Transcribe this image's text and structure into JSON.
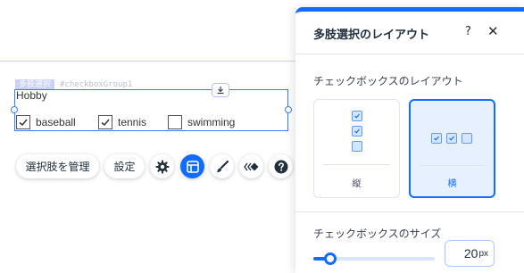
{
  "canvas": {
    "element_type": "多肢選択",
    "element_id": "#checkboxGroup1",
    "title": "Hobby",
    "options": [
      {
        "label": "baseball",
        "checked": true
      },
      {
        "label": "tennis",
        "checked": true
      },
      {
        "label": "swimming",
        "checked": false
      }
    ]
  },
  "toolbar": {
    "manage_label": "選択肢を管理",
    "settings_label": "設定",
    "icons": [
      "gear-icon",
      "layout-icon",
      "design-brush-icon",
      "animation-icon",
      "help-icon"
    ],
    "active_icon": "layout-icon"
  },
  "panel": {
    "title": "多肢選択のレイアウト",
    "help": "?",
    "close": "✕",
    "layout_section_label": "チェックボックスのレイアウト",
    "layouts": [
      {
        "label": "縦",
        "selected": false
      },
      {
        "label": "横",
        "selected": true
      }
    ],
    "size_section_label": "チェックボックスのサイズ",
    "size_value": "20",
    "size_unit": "px",
    "size_slider_fraction": 0.1
  },
  "colors": {
    "accent": "#116dff",
    "selection": "#3b7ef0"
  }
}
